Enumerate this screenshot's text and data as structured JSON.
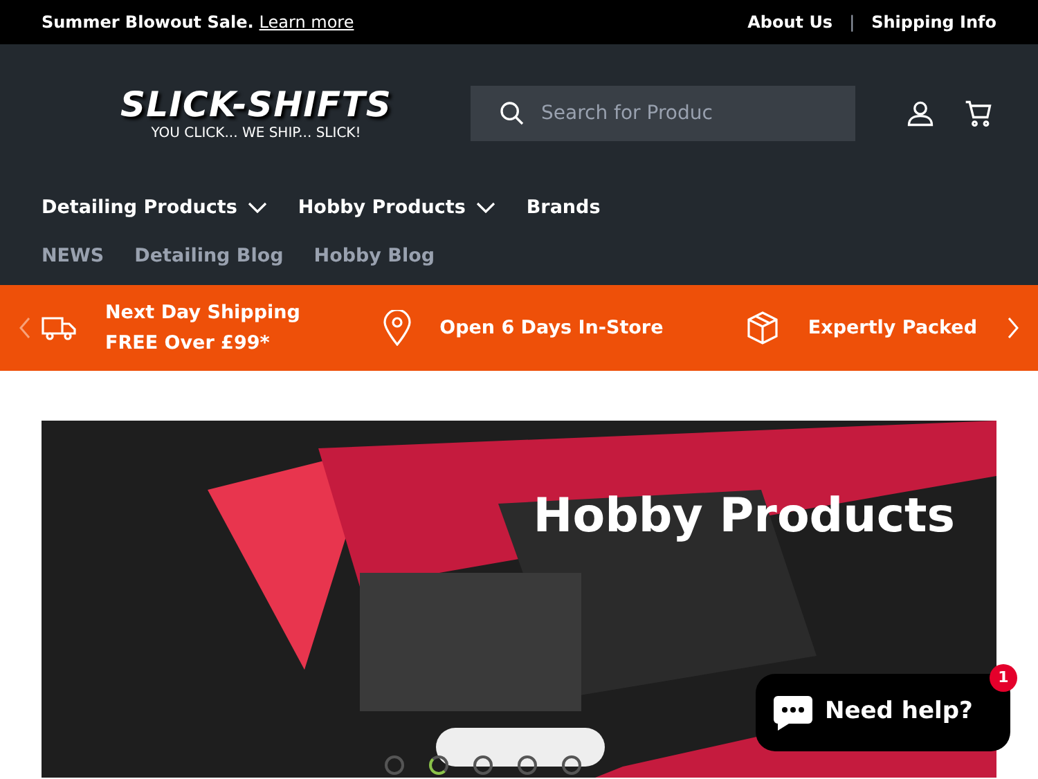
{
  "announcement": {
    "text": "Summer Blowout Sale.",
    "link": "Learn more",
    "links": [
      "About Us",
      "Shipping Info"
    ],
    "separator": "|"
  },
  "header": {
    "logo": {
      "name": "SLICK-SHIFTS",
      "tagline": "YOU CLICK... WE SHIP... SLICK!"
    },
    "search": {
      "placeholder": "Search for Produc"
    }
  },
  "nav": {
    "primary": [
      {
        "label": "Detailing Products",
        "dropdown": true
      },
      {
        "label": "Hobby Products",
        "dropdown": true
      },
      {
        "label": "Brands",
        "dropdown": false
      }
    ],
    "secondary": [
      "NEWS",
      "Detailing Blog",
      "Hobby Blog"
    ]
  },
  "usp_bar": [
    {
      "kind": "truck",
      "lines": [
        "Next Day Shipping",
        "FREE Over £99*"
      ]
    },
    {
      "kind": "pin",
      "lines": [
        "Open 6 Days In-Store"
      ]
    },
    {
      "kind": "box",
      "lines": [
        "Expertly Packed"
      ]
    }
  ],
  "hero": {
    "heading": "Hobby Products",
    "slides": [
      {
        "selected": false
      },
      {
        "selected": true
      },
      {
        "selected": false
      },
      {
        "selected": false
      },
      {
        "selected": false
      }
    ]
  },
  "chat": {
    "label": "Need help?",
    "badge": "1"
  }
}
